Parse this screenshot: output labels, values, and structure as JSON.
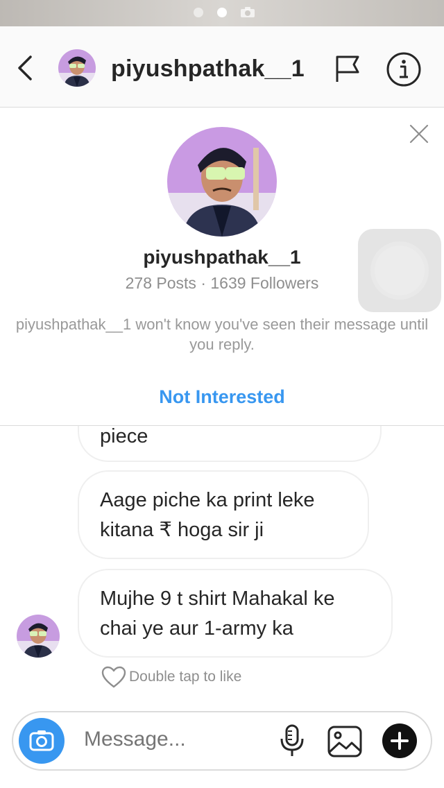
{
  "header": {
    "username": "piyushpathak__1"
  },
  "profile_card": {
    "username": "piyushpathak__1",
    "stats": "278 Posts · 1639 Followers",
    "note": "piyushpathak__1 won't know you've seen their message until you reply.",
    "not_interested_label": "Not Interested"
  },
  "messages": [
    {
      "text": "piece"
    },
    {
      "line1": "Aage piche ka print leke",
      "line2": "kitana ₹ hoga sir ji"
    },
    {
      "line1": "Mujhe 9 t shirt Mahakal ke",
      "line2": "chai ye aur 1-army ka"
    }
  ],
  "like_hint": "Double tap to like",
  "composer": {
    "placeholder": "Message..."
  },
  "icons": {
    "back": "chevron-left-icon",
    "flag": "flag-icon",
    "info": "info-icon",
    "close": "close-icon",
    "heart": "heart-icon",
    "camera": "camera-icon",
    "mic": "microphone-icon",
    "gallery": "gallery-icon",
    "plus": "plus-icon"
  },
  "colors": {
    "accent": "#3897f0",
    "text": "#262626",
    "muted": "#8e8e8e",
    "border": "#dbdbdb"
  }
}
